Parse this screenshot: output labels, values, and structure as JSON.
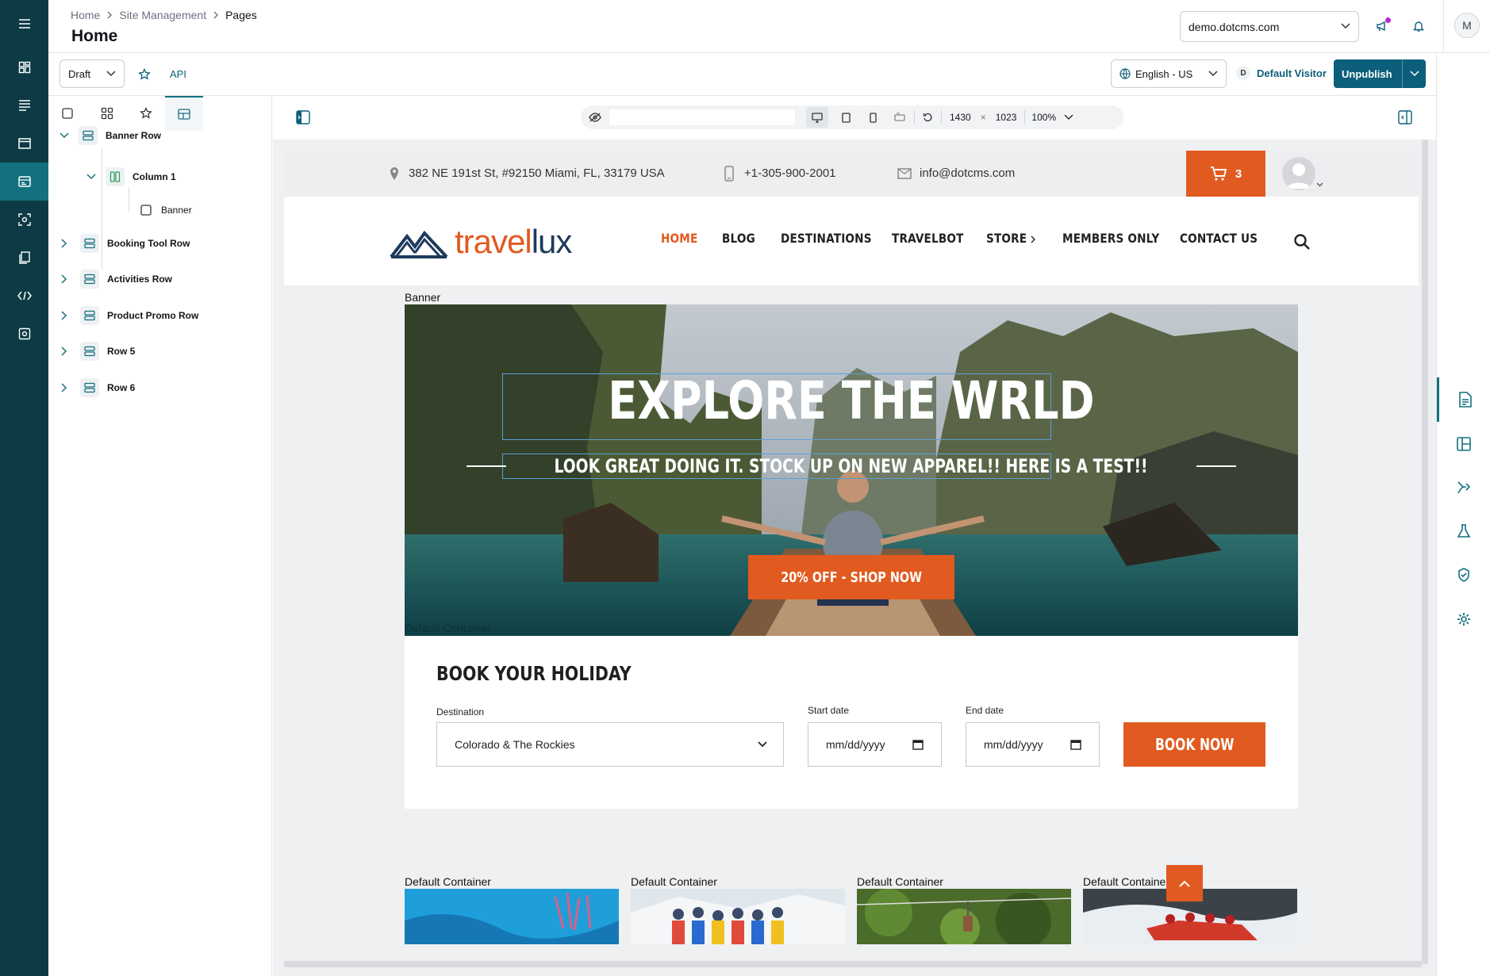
{
  "header": {
    "breadcrumbs": [
      "Home",
      "Site Management",
      "Pages"
    ],
    "title": "Home",
    "site": "demo.dotcms.com",
    "user_initial": "M"
  },
  "toolbar": {
    "status": "Draft",
    "api_label": "API",
    "language": "English - US",
    "persona_badge": "D",
    "persona": "Default Visitor",
    "unpublish_label": "Unpublish"
  },
  "tree": {
    "rows": [
      {
        "label": "Banner Row",
        "expanded": true
      },
      {
        "label": "Column 1",
        "expanded": true
      },
      {
        "label": "Banner"
      },
      {
        "label": "Booking Tool Row"
      },
      {
        "label": "Activities Row"
      },
      {
        "label": "Product Promo Row"
      },
      {
        "label": "Row 5"
      },
      {
        "label": "Row 6"
      }
    ]
  },
  "device_bar": {
    "width": "1430",
    "times": "×",
    "height": "1023",
    "zoom": "100%"
  },
  "site": {
    "address": "382 NE 191st St, #92150 Miami, FL, 33179 USA",
    "phone": "+1-305-900-2001",
    "email": "info@dotcms.com",
    "cart_count": "3",
    "logo_text_1": "travel",
    "logo_text_2": "lux",
    "nav": [
      "HOME",
      "BLOG",
      "DESTINATIONS",
      "TRAVELBOT",
      "STORE",
      "MEMBERS ONLY",
      "CONTACT US"
    ],
    "banner_label": "Banner",
    "hero_title": "EXPLORE THE WRLD",
    "hero_subtitle": "LOOK GREAT DOING IT. STOCK UP ON NEW APPAREL!! HERE IS A TEST!!",
    "hero_cta": "20% OFF - SHOP NOW",
    "container_overlay": "Default Container",
    "booking_title": "BOOK YOUR HOLIDAY",
    "destination_label": "Destination",
    "destination_value": "Colorado & The Rockies",
    "start_label": "Start date",
    "end_label": "End date",
    "date_placeholder": "mm/dd/yyyy",
    "book_now": "BOOK NOW",
    "containers": [
      "Default Container",
      "Default Container",
      "Default Container",
      "Default Container"
    ]
  },
  "colors": {
    "rail": "#0c3b45",
    "accent": "#14707e",
    "primary_button": "#0c5f7a",
    "brand_orange": "#e15a1f"
  }
}
